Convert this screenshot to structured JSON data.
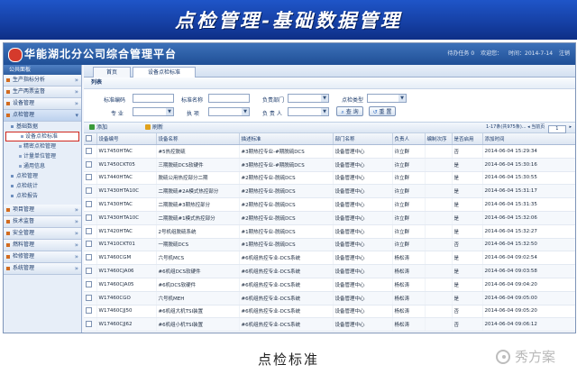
{
  "slide_title": "点检管理-基础数据管理",
  "caption": "点检标准",
  "watermark": "秀方案",
  "app": {
    "title": "华能湖北分公司综合管理平台",
    "topbar": {
      "tasks": "待办任务 0",
      "user": "欢迎您：",
      "date": "时间：2014-7-14",
      "exit": "注销"
    }
  },
  "sidebar": {
    "header": "公共面板",
    "groups_top": [
      "生产指标分析",
      "生产两票监督",
      "设备管理"
    ],
    "open_group": "点检管理",
    "sub_folder": "基础数据",
    "sub_items": [
      "设备点检标准",
      "精密点检管理",
      "计量单位管理",
      "通用信息"
    ],
    "active_index": 0,
    "folders": [
      "点检管理",
      "点检统计",
      "点检报告"
    ],
    "groups_bottom": [
      "项目管理",
      "技术监督",
      "安全管理",
      "燃料管理",
      "检修管理",
      "系统管理"
    ]
  },
  "tabs": [
    "首页",
    "设备点检标准"
  ],
  "panel_title": "列表",
  "filters": {
    "code_label": "标准编码",
    "name_label": "标准名称",
    "dept_label": "负责部门",
    "type_label": "点检类型",
    "major_label": "专 业",
    "exec_label": "执 项",
    "owner_label": "负 责 人",
    "search_btn": "查 询",
    "reset_btn": "重 置"
  },
  "toolbar": {
    "add": "添加",
    "refresh": "刷新",
    "pager_text": "1-17条(共975条)...",
    "page_label": "当前页",
    "page_value": "1"
  },
  "table": {
    "columns": [
      "设备编号",
      "设备名称",
      "描述标准",
      "部门名称",
      "负责人",
      "编制次序",
      "是否启用",
      "添加时间"
    ],
    "rows": [
      [
        "W17450HTAC",
        "#5热控脱硫",
        "#3期热控专业-#期脱硫DCS",
        "设备管理中心",
        "许立群",
        "",
        "否",
        "2014-06-04 15:29:34"
      ],
      [
        "W17450CKT05",
        "三期脱硫DCS软硬件",
        "#3期热控专业-#期脱硫DCS",
        "设备管理中心",
        "许立群",
        "",
        "是",
        "2014-06-04 15:30:16"
      ],
      [
        "W17440HTAC",
        "脱硫公用热控部分二期",
        "#2期热控专业-脱硫DCS",
        "设备管理中心",
        "许立群",
        "",
        "是",
        "2014-06-04 15:30:55"
      ],
      [
        "W17430HTA10C",
        "二期脱硫#2A模式热控部分",
        "#2期热控专业-脱硫DCS",
        "设备管理中心",
        "许立群",
        "",
        "是",
        "2014-06-04 15:31:17"
      ],
      [
        "W17430HTAC",
        "二期脱硫#3期热控部分",
        "#2期热控专业-脱硫DCS",
        "设备管理中心",
        "许立群",
        "",
        "是",
        "2014-06-04 15:31:35"
      ],
      [
        "W17430HTA10C",
        "二期脱硫#1模式热控部分",
        "#2期热控专业-脱硫DCS",
        "设备管理中心",
        "许立群",
        "",
        "是",
        "2014-06-04 15:32:06"
      ],
      [
        "W17420HTAC",
        "2号机组脱硫系统",
        "#1期热控专业-脱硫DCS",
        "设备管理中心",
        "许立群",
        "",
        "是",
        "2014-06-04 15:32:27"
      ],
      [
        "W17410CKT01",
        "一期脱硫DCS",
        "#1期热控专业-脱硫DCS",
        "设备管理中心",
        "许立群",
        "",
        "否",
        "2014-06-04 15:32:50"
      ],
      [
        "W17460CGM",
        "六号机MCS",
        "#6机组热控专业-DCS系统",
        "设备管理中心",
        "杨松涛",
        "",
        "是",
        "2014-06-04 09:02:54"
      ],
      [
        "W17460CJA06",
        "#6机组DCS软硬件",
        "#6机组热控专业-DCS系统",
        "设备管理中心",
        "杨松涛",
        "",
        "是",
        "2014-06-04 09:03:58"
      ],
      [
        "W17460CJA05",
        "#6机DCS软硬件",
        "#6机组热控专业-DCS系统",
        "设备管理中心",
        "杨松涛",
        "",
        "是",
        "2014-06-04 09:04:20"
      ],
      [
        "W17460CGO",
        "六号机MEH",
        "#6机组热控专业-DCS系统",
        "设备管理中心",
        "杨松涛",
        "",
        "是",
        "2014-06-04 09:05:00"
      ],
      [
        "W17460CJJ50",
        "#6机组大机TSI装置",
        "#6机组热控专业-DCS系统",
        "设备管理中心",
        "杨松涛",
        "",
        "否",
        "2014-06-04 09:05:20"
      ],
      [
        "W17460CJJ62",
        "#6机组小机TSI装置",
        "#6机组热控专业-DCS系统",
        "设备管理中心",
        "杨松涛",
        "",
        "否",
        "2014-06-04 09:06:12"
      ]
    ]
  }
}
